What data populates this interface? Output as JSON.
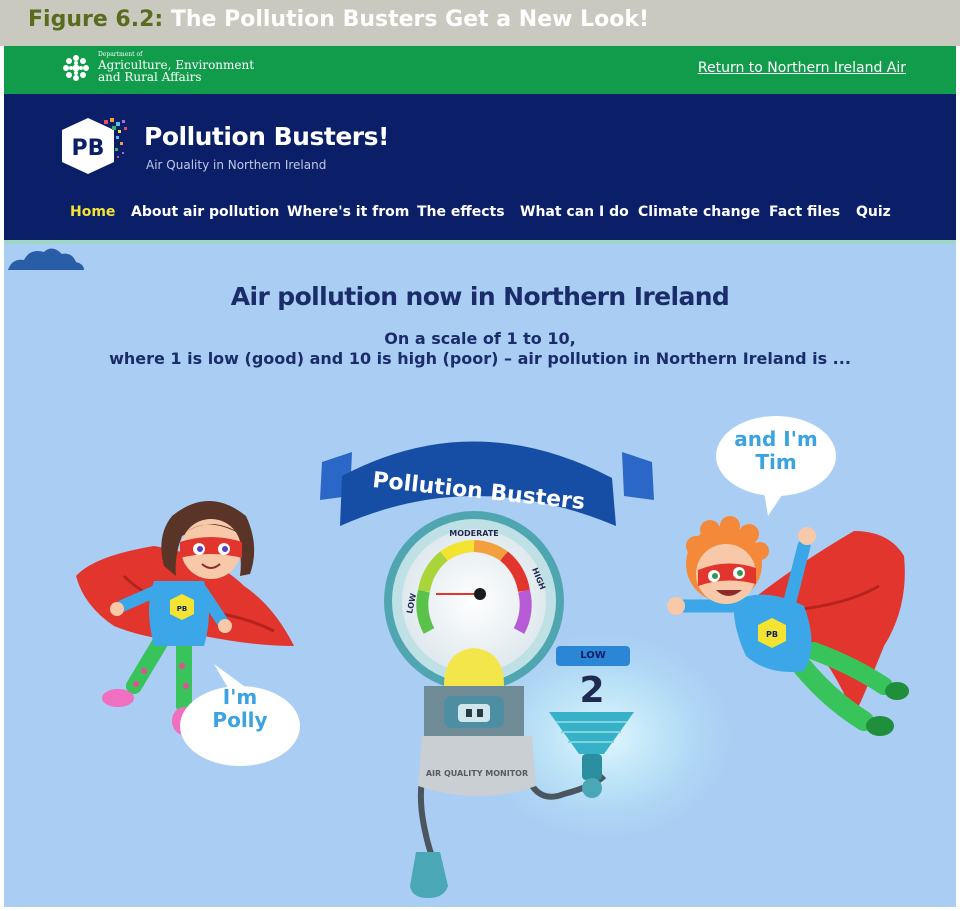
{
  "figure": {
    "number": "Figure 6.2:",
    "title": "The Pollution Busters Get a New Look!"
  },
  "gov_bar": {
    "dept_small": "Department of",
    "dept_line1": "Agriculture, Environment",
    "dept_line2": "and Rural Affairs",
    "return_link": "Return to Northern Ireland Air"
  },
  "site": {
    "logo_text": "PB",
    "title": "Pollution Busters!",
    "subtitle": "Air Quality in Northern Ireland"
  },
  "nav": {
    "items": [
      {
        "label": "Home",
        "active": true
      },
      {
        "label": "About air pollution",
        "active": false
      },
      {
        "label": "Where's it from",
        "active": false
      },
      {
        "label": "The effects",
        "active": false
      },
      {
        "label": "What can I do",
        "active": false
      },
      {
        "label": "Climate change",
        "active": false
      },
      {
        "label": "Fact files",
        "active": false
      },
      {
        "label": "Quiz",
        "active": false
      }
    ]
  },
  "main": {
    "heading": "Air pollution now in Northern Ireland",
    "scale_line1": "On a scale of 1 to 10,",
    "scale_line2": "where 1 is low (good) and 10 is high (poor) – air pollution in Northern Ireland is ..."
  },
  "monitor": {
    "banner": "Pollution Busters",
    "gauge_low": "LOW",
    "gauge_moderate": "MODERATE",
    "gauge_high": "HIGH",
    "body_label": "AIR QUALITY MONITOR",
    "level_label": "LOW",
    "level_value": "2"
  },
  "characters": {
    "polly_speech_1": "I'm",
    "polly_speech_2": "Polly",
    "tim_speech_1": "and I'm",
    "tim_speech_2": "Tim",
    "badge": "PB"
  },
  "colors": {
    "gov_green": "#119c4b",
    "header_navy": "#0b1f68",
    "nav_active": "#f5e331",
    "content_bg": "#a9cdf3",
    "heading_navy": "#1b2c6a",
    "speech_blue": "#3aa3e0"
  }
}
